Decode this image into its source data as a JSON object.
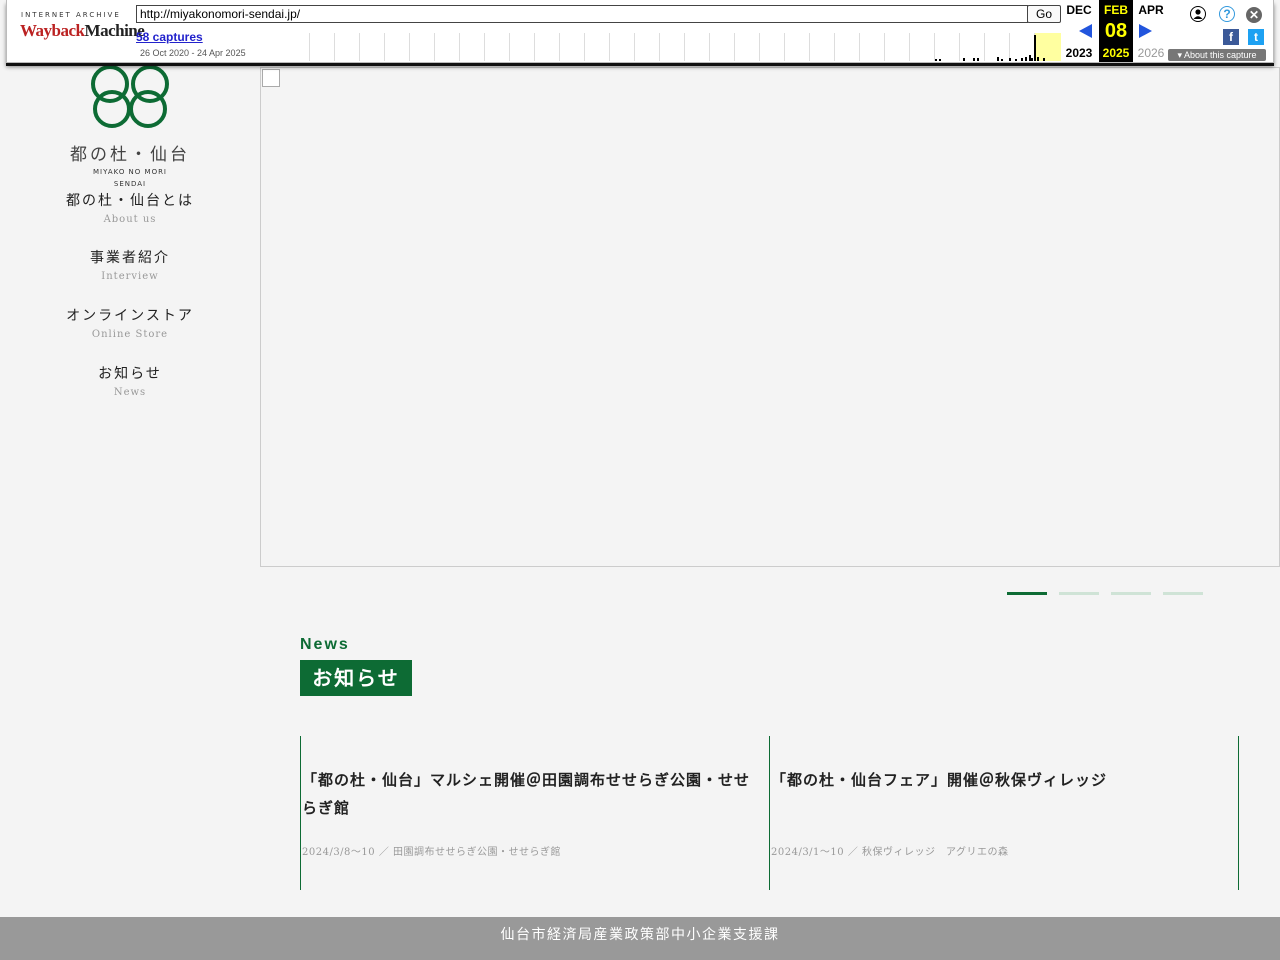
{
  "wayback": {
    "ia_label": "INTERNET ARCHIVE",
    "logo_wayback": "Wayback",
    "logo_machine": "Machine",
    "url": "http://miyakonomori-sendai.jp/",
    "go_label": "Go",
    "captures_link": "58 captures",
    "capture_range": "26 Oct 2020 - 24 Apr 2025",
    "prev_month": "DEC",
    "prev_year": "2023",
    "cur_month": "FEB",
    "cur_day": "08",
    "cur_year": "2025",
    "next_month": "APR",
    "next_year": "2026",
    "about_capture": "About this capture",
    "icons": [
      "user-icon",
      "help-icon",
      "close-icon",
      "facebook-icon",
      "twitter-icon"
    ],
    "accent_color": "#ffff00"
  },
  "site": {
    "logo_jp": "都の杜・仙台",
    "logo_en_line1": "MIYAKO NO MORI",
    "logo_en_line2": "SENDAI",
    "brand_color": "#0d6b34",
    "nav": [
      {
        "jp": "都の杜・仙台とは",
        "en": "About us"
      },
      {
        "jp": "事業者紹介",
        "en": "Interview"
      },
      {
        "jp": "オンラインストア",
        "en": "Online Store"
      },
      {
        "jp": "お知らせ",
        "en": "News"
      }
    ],
    "slider_dots": 4,
    "slider_active_index": 0
  },
  "news": {
    "heading_en": "News",
    "heading_jp": "お知らせ",
    "items": [
      {
        "title": "「都の杜・仙台」マルシェ開催＠田園調布せせらぎ公園・せせらぎ館",
        "meta": "2024/3/8～10 ／ 田園調布せせらぎ公園・せせらぎ館"
      },
      {
        "title": "「都の杜・仙台フェア」開催＠秋保ヴィレッジ",
        "meta": "2024/3/1～10 ／ 秋保ヴィレッジ　アグリエの森"
      }
    ]
  },
  "footer": {
    "text": "仙台市経済局産業政策部中小企業支援課"
  }
}
